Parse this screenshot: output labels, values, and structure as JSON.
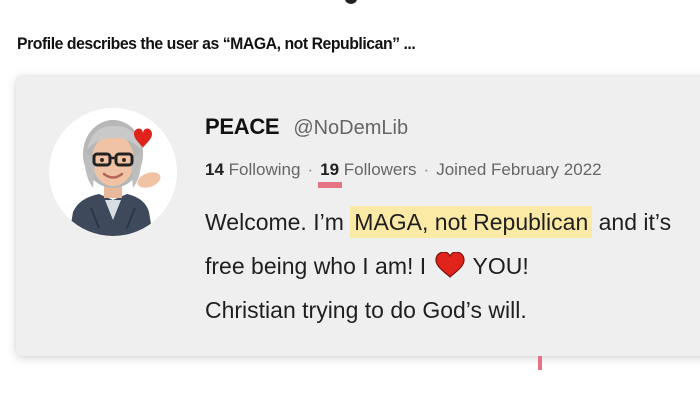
{
  "caption": "Profile describes the user as “MAGA, not Republican” ...",
  "profile": {
    "display_name": "PEACE",
    "handle": "@NoDemLib",
    "following_count": "14",
    "following_label": "Following",
    "followers_count": "19",
    "followers_label": "Followers",
    "joined": "Joined February 2022",
    "separator": "·",
    "bio": {
      "line1_before": "Welcome. I’m ",
      "line1_highlight": "MAGA, not Republican",
      "line1_after": " and it’s free being who I am! I ",
      "heart": "heart-emoji-icon",
      "line2_after": " YOU!",
      "line3": "Christian trying to do God’s will."
    },
    "avatar": "memoji-avatar-icon"
  },
  "colors": {
    "card_background": "#efefef",
    "highlight": "#fbe9a6",
    "underline_annotation": "#e57383",
    "heart_red": "#e0241b",
    "muted_text": "#666666"
  }
}
